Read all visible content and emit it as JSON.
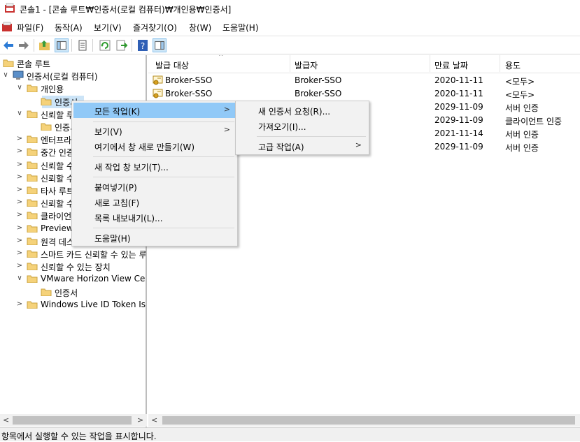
{
  "window": {
    "title": "콘솔1 - [콘솔 루트₩인증서(로컬 컴퓨터)₩개인용₩인증서]"
  },
  "menubar": [
    "파일(F)",
    "동작(A)",
    "보기(V)",
    "즐겨찾기(O)",
    "창(W)",
    "도움말(H)"
  ],
  "toolbar": {
    "icons": [
      "back-icon",
      "forward-icon",
      "up-folder-icon",
      "show-hide-tree-icon",
      "properties-icon",
      "refresh-icon",
      "export-list-icon",
      "help-icon",
      "action-pane-icon"
    ]
  },
  "tree": [
    {
      "label": "콘솔 루트",
      "chevron": "",
      "type": "folder"
    },
    {
      "label": "인증서(로컬 컴퓨터)",
      "chevron": "expanded",
      "type": "computer"
    },
    {
      "label": "개인용",
      "chevron": "expanded",
      "type": "folder"
    },
    {
      "label": "인증서",
      "chevron": "",
      "type": "folder",
      "selected": true
    },
    {
      "label": "신뢰할 루트 인증 기관",
      "chevron": "expanded",
      "type": "folder"
    },
    {
      "label": "인증서",
      "chevron": "",
      "type": "folder"
    },
    {
      "label": "엔터프라이즈 신뢰",
      "chevron": "collapsed",
      "type": "folder"
    },
    {
      "label": "중간 인증 기관",
      "chevron": "collapsed",
      "type": "folder"
    },
    {
      "label": "신뢰할 수 있는 게시자",
      "chevron": "collapsed",
      "type": "folder"
    },
    {
      "label": "신뢰할 수 없는 인증서",
      "chevron": "collapsed",
      "type": "folder"
    },
    {
      "label": "타사 루트 인증 기관",
      "chevron": "collapsed",
      "type": "folder"
    },
    {
      "label": "신뢰할 수 있는 사용자",
      "chevron": "collapsed",
      "type": "folder"
    },
    {
      "label": "클라이언트 인증 발급자",
      "chevron": "collapsed",
      "type": "folder"
    },
    {
      "label": "Preview Build Roots",
      "chevron": "collapsed",
      "type": "folder"
    },
    {
      "label": "원격 데스크톱",
      "chevron": "collapsed",
      "type": "folder"
    },
    {
      "label": "스마트 카드 신뢰할 수 있는 루트",
      "chevron": "collapsed",
      "type": "folder"
    },
    {
      "label": "신뢰할 수 있는 장치",
      "chevron": "collapsed",
      "type": "folder"
    },
    {
      "label": "VMware Horizon View Certificates",
      "chevron": "expanded",
      "type": "folder"
    },
    {
      "label": "인증서",
      "chevron": "",
      "type": "folder"
    },
    {
      "label": "Windows Live ID Token Issuer",
      "chevron": "collapsed",
      "type": "folder"
    }
  ],
  "list": {
    "columns": [
      "발급 대상",
      "발급자",
      "만료 날짜",
      "용도"
    ],
    "rows": [
      {
        "subject": "Broker-SSO",
        "issuer": "Broker-SSO",
        "expires": "2020-11-11",
        "purpose": "<모두>"
      },
      {
        "subject": "Broker-SSO",
        "issuer": "Broker-SSO",
        "expires": "2020-11-11",
        "purpose": "<모두>"
      },
      {
        "subject": "",
        "issuer": "ew Gateway ...",
        "expires": "2029-11-09",
        "purpose": "서버 인증"
      },
      {
        "subject": "",
        "issuer": "ew Gateway ...",
        "expires": "2029-11-09",
        "purpose": "클라이언트 인증"
      },
      {
        "subject": "",
        "issuer": "CA",
        "expires": "2021-11-14",
        "purpose": "서버 인증"
      },
      {
        "subject": "",
        "issuer": "ocal",
        "expires": "2029-11-09",
        "purpose": "서버 인증"
      }
    ]
  },
  "context_menu": {
    "items": [
      "모든 작업(K)",
      "보기(V)",
      "여기에서 창 새로 만들기(W)",
      "새 작업 창 보기(T)...",
      "붙여넣기(P)",
      "새로 고침(F)",
      "목록 내보내기(L)...",
      "도움말(H)"
    ]
  },
  "submenu": {
    "items": [
      "새 인증서 요청(R)...",
      "가져오기(I)...",
      "고급 작업(A)"
    ]
  },
  "statusbar": {
    "text": "항목에서 실행할 수 있는 작업을 표시합니다."
  },
  "colors": {
    "highlight": "#91c9f7",
    "folder": "#f5d27a",
    "menu_bg": "#f2f2f2"
  }
}
